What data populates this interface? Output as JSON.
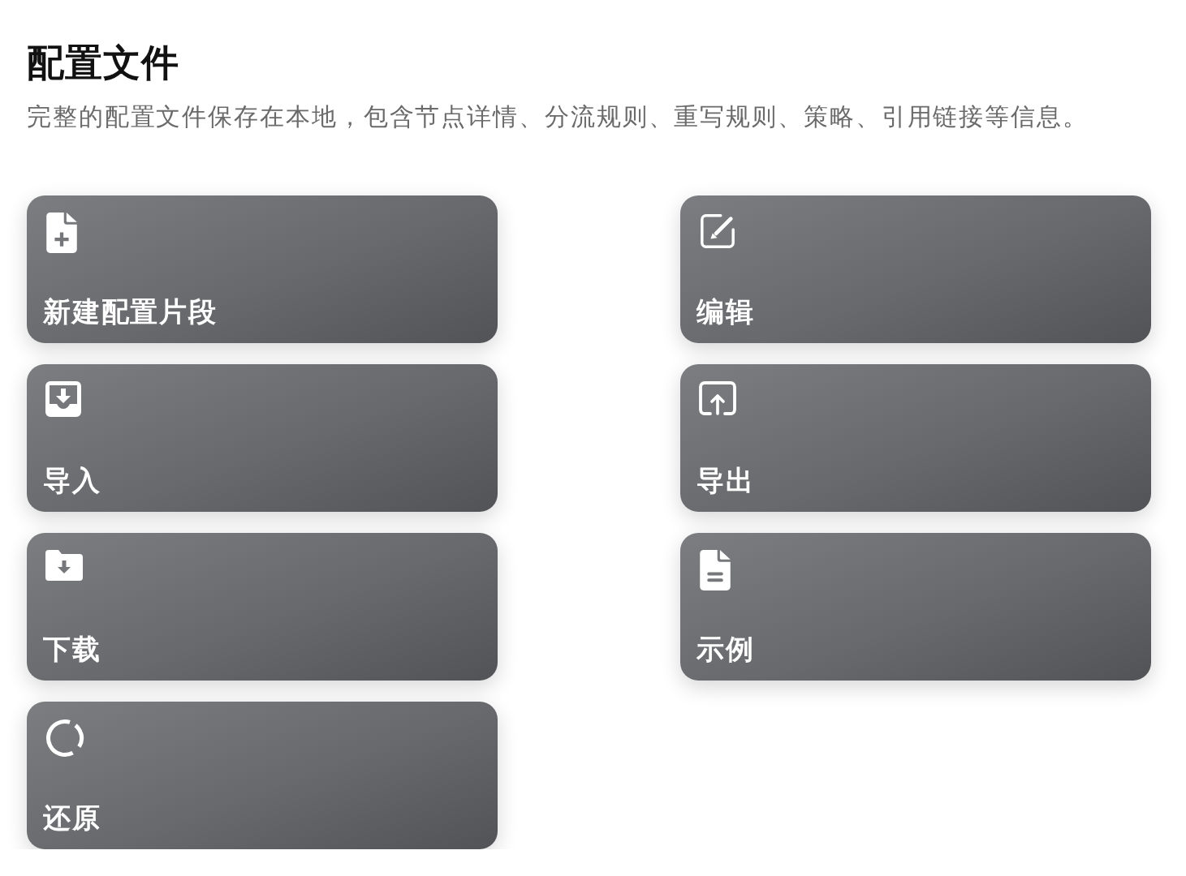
{
  "header": {
    "title": "配置文件",
    "description": "完整的配置文件保存在本地，包含节点详情、分流规则、重写规则、策略、引用链接等信息。"
  },
  "actions": [
    {
      "label": "新建配置片段"
    },
    {
      "label": "编辑"
    },
    {
      "label": "导入"
    },
    {
      "label": "导出"
    },
    {
      "label": "下载"
    },
    {
      "label": "示例"
    },
    {
      "label": "还原"
    }
  ]
}
